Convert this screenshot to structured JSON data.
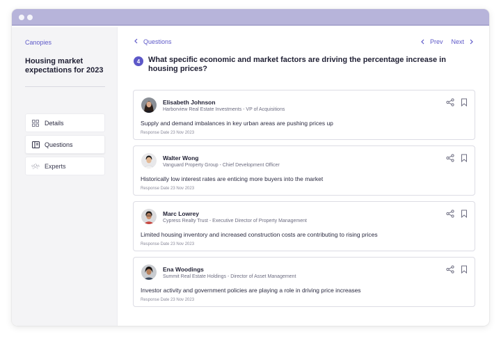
{
  "sidebar": {
    "brand": "Canopies",
    "project_title": "Housing market expectations for 2023",
    "items": [
      {
        "label": "Details",
        "icon": "grid-icon"
      },
      {
        "label": "Questions",
        "icon": "book-icon"
      },
      {
        "label": "Experts",
        "icon": "people-icon"
      }
    ]
  },
  "main": {
    "back_label": "Questions",
    "prev_label": "Prev",
    "next_label": "Next",
    "question_number": "4",
    "question_text": "What specific economic and market factors are driving the percentage increase in housing prices?",
    "responses": [
      {
        "name": "Elisabeth Johnson",
        "role": "Harborview Real Estate Investments - VP of Acquisitions",
        "answer": "Supply and demand imbalances in key urban areas are pushing prices up",
        "date": "Response Date 23 Nov 2023"
      },
      {
        "name": "Walter Wong",
        "role": "Vanguard Property Group - Chief Development Officer",
        "answer": "Historically low interest rates are enticing more buyers into the market",
        "date": "Response Date 23 Nov 2023"
      },
      {
        "name": "Marc Lowrey",
        "role": "Cypress Realty Trust - Executive Director of Property Management",
        "answer": "Limited housing inventory and increased construction costs are contributing to rising prices",
        "date": "Response Date 23 Nov 2023"
      },
      {
        "name": "Ena Woodings",
        "role": "Summit Real Estate Holdings - Director of Asset Management",
        "answer": "Investor activity and government policies are playing a role in driving price increases",
        "date": "Response Date 23 Nov 2023"
      }
    ]
  },
  "colors": {
    "accent": "#5d58c8",
    "titlebar": "#b7b4da",
    "sidebar_bg": "#f4f4f6"
  }
}
